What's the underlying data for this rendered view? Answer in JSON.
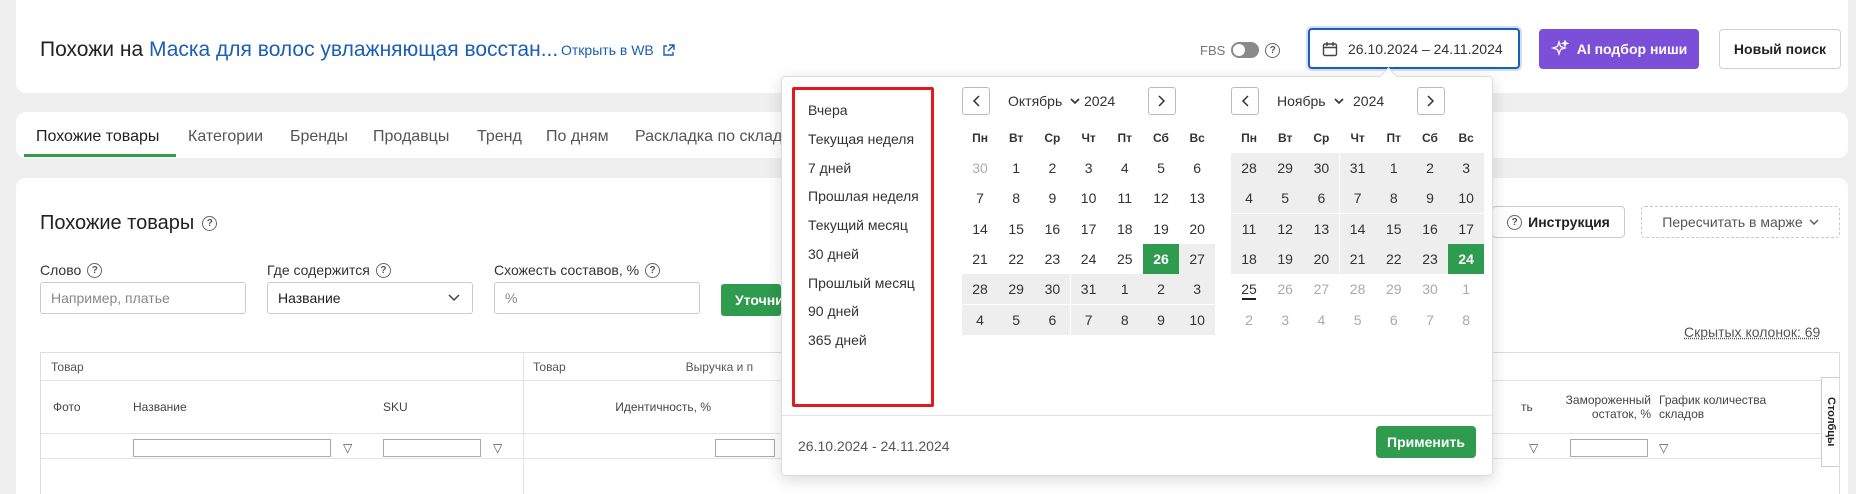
{
  "header": {
    "title_prefix": "Похожи на",
    "title_link": "Маска для волос увлажняющая восстан...",
    "open_wb": "Открыть в WB",
    "fbs_label": "FBS",
    "date_range": "26.10.2024 – 24.11.2024",
    "ai_button": "AI подбор ниши",
    "new_search": "Новый поиск"
  },
  "tabs": [
    "Похожие товары",
    "Категории",
    "Бренды",
    "Продавцы",
    "Тренд",
    "По дням",
    "Раскладка по склад"
  ],
  "panel": {
    "title": "Похожие товары",
    "instruction": "Инструкция",
    "recalc": "Пересчитать в марже",
    "hidden_columns": "Скрытых колонок: 69",
    "refine_button": "Уточни",
    "filters": {
      "word_label": "Слово",
      "word_placeholder": "Например, платье",
      "where_label": "Где содержится",
      "where_value": "Название",
      "similarity_label": "Схожесть составов, %",
      "similarity_placeholder": "%"
    }
  },
  "table": {
    "group_left": "Товар",
    "group_right": "Товар",
    "group_revenue": "Выручка и п",
    "col_photo": "Фото",
    "col_name": "Название",
    "col_sku": "SKU",
    "col_identity": "Идентичность, %",
    "col_t": "ть",
    "col_frozen": "Замороженный остаток, %",
    "col_chart": "График количества складов",
    "side_tab": "Столбцы"
  },
  "datepicker": {
    "presets": [
      "Вчера",
      "Текущая неделя",
      "7 дней",
      "Прошлая неделя",
      "Текущий месяц",
      "30 дней",
      "Прошлый месяц",
      "90 дней",
      "365 дней"
    ],
    "weekdays": [
      "Пн",
      "Вт",
      "Ср",
      "Чт",
      "Пт",
      "Сб",
      "Вс"
    ],
    "left": {
      "month": "Октябрь",
      "year": "2024",
      "days": [
        [
          "30",
          "1",
          "2",
          "3",
          "4",
          "5",
          "6"
        ],
        [
          "7",
          "8",
          "9",
          "10",
          "11",
          "12",
          "13"
        ],
        [
          "14",
          "15",
          "16",
          "17",
          "18",
          "19",
          "20"
        ],
        [
          "21",
          "22",
          "23",
          "24",
          "25",
          "26",
          "27"
        ],
        [
          "28",
          "29",
          "30",
          "31",
          "1",
          "2",
          "3"
        ],
        [
          "4",
          "5",
          "6",
          "7",
          "8",
          "9",
          "10"
        ]
      ]
    },
    "right": {
      "month": "Ноябрь",
      "year": "2024",
      "days": [
        [
          "28",
          "29",
          "30",
          "31",
          "1",
          "2",
          "3"
        ],
        [
          "4",
          "5",
          "6",
          "7",
          "8",
          "9",
          "10"
        ],
        [
          "11",
          "12",
          "13",
          "14",
          "15",
          "16",
          "17"
        ],
        [
          "18",
          "19",
          "20",
          "21",
          "22",
          "23",
          "24"
        ],
        [
          "25",
          "26",
          "27",
          "28",
          "29",
          "30",
          "1"
        ],
        [
          "2",
          "3",
          "4",
          "5",
          "6",
          "7",
          "8"
        ]
      ]
    },
    "footer_range": "26.10.2024 - 24.11.2024",
    "apply": "Применить"
  },
  "colors": {
    "accent_green": "#2e9b4e",
    "link_blue": "#1a5fb4",
    "ai_purple": "#7b4fd8",
    "highlight_red": "#e11b1b"
  }
}
